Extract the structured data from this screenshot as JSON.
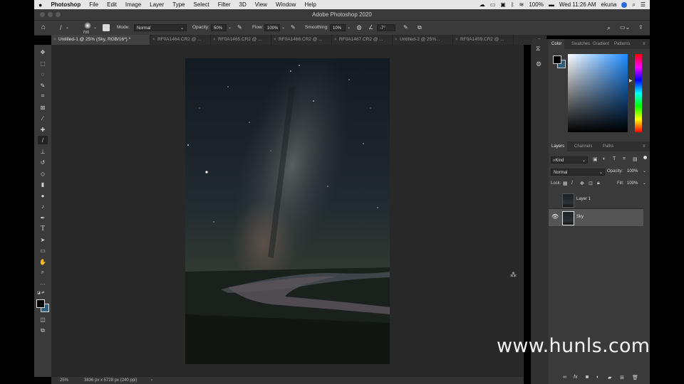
{
  "menubar": {
    "app": "Photoshop",
    "items": [
      "File",
      "Edit",
      "Image",
      "Layer",
      "Type",
      "Select",
      "Filter",
      "3D",
      "View",
      "Window",
      "Help"
    ],
    "battery": "100%",
    "clock": "Wed 11:26 AM",
    "user": "ekuna"
  },
  "window": {
    "title": "Adobe Photoshop 2020"
  },
  "options": {
    "brush_size": "700",
    "mode_label": "Mode:",
    "mode_value": "Normal",
    "opacity_label": "Opacity:",
    "opacity_value": "50%",
    "flow_label": "Flow:",
    "flow_value": "100%",
    "smoothing_label": "Smoothing:",
    "smoothing_value": "10%",
    "angle_value": "-7°"
  },
  "tabs": [
    {
      "label": "Untitled-1 @ 25% (Sky, RGB/16*) *"
    },
    {
      "label": "RF0A1464.CR2 @ ..."
    },
    {
      "label": "RF0A1465.CR2 @ ..."
    },
    {
      "label": "RF0A1466.CR2 @ ..."
    },
    {
      "label": "RF0A1467.CR2 @ ..."
    },
    {
      "label": "Untitled-2 @ 25%..."
    },
    {
      "label": "RF0A1459.CR2 @ ..."
    }
  ],
  "status": {
    "zoom": "25%",
    "doc_info": "3836 px x 5728 px (240 ppi)"
  },
  "color_panel": {
    "tabs": [
      "Color",
      "Swatches",
      "Gradient",
      "Patterns"
    ],
    "foreground": "#000000",
    "background": "#ffffff"
  },
  "layers_panel": {
    "tabs": [
      "Layers",
      "Channels",
      "Paths"
    ],
    "filter_kind": "Kind",
    "blend_mode": "Normal",
    "opacity_label": "Opacity:",
    "opacity_value": "100%",
    "lock_label": "Lock:",
    "fill_label": "Fill:",
    "fill_value": "100%",
    "layers": [
      {
        "name": "Layer 1",
        "visible": false,
        "selected": false
      },
      {
        "name": "Sky",
        "visible": true,
        "selected": true
      }
    ]
  },
  "watermark": "www.hunls.com"
}
